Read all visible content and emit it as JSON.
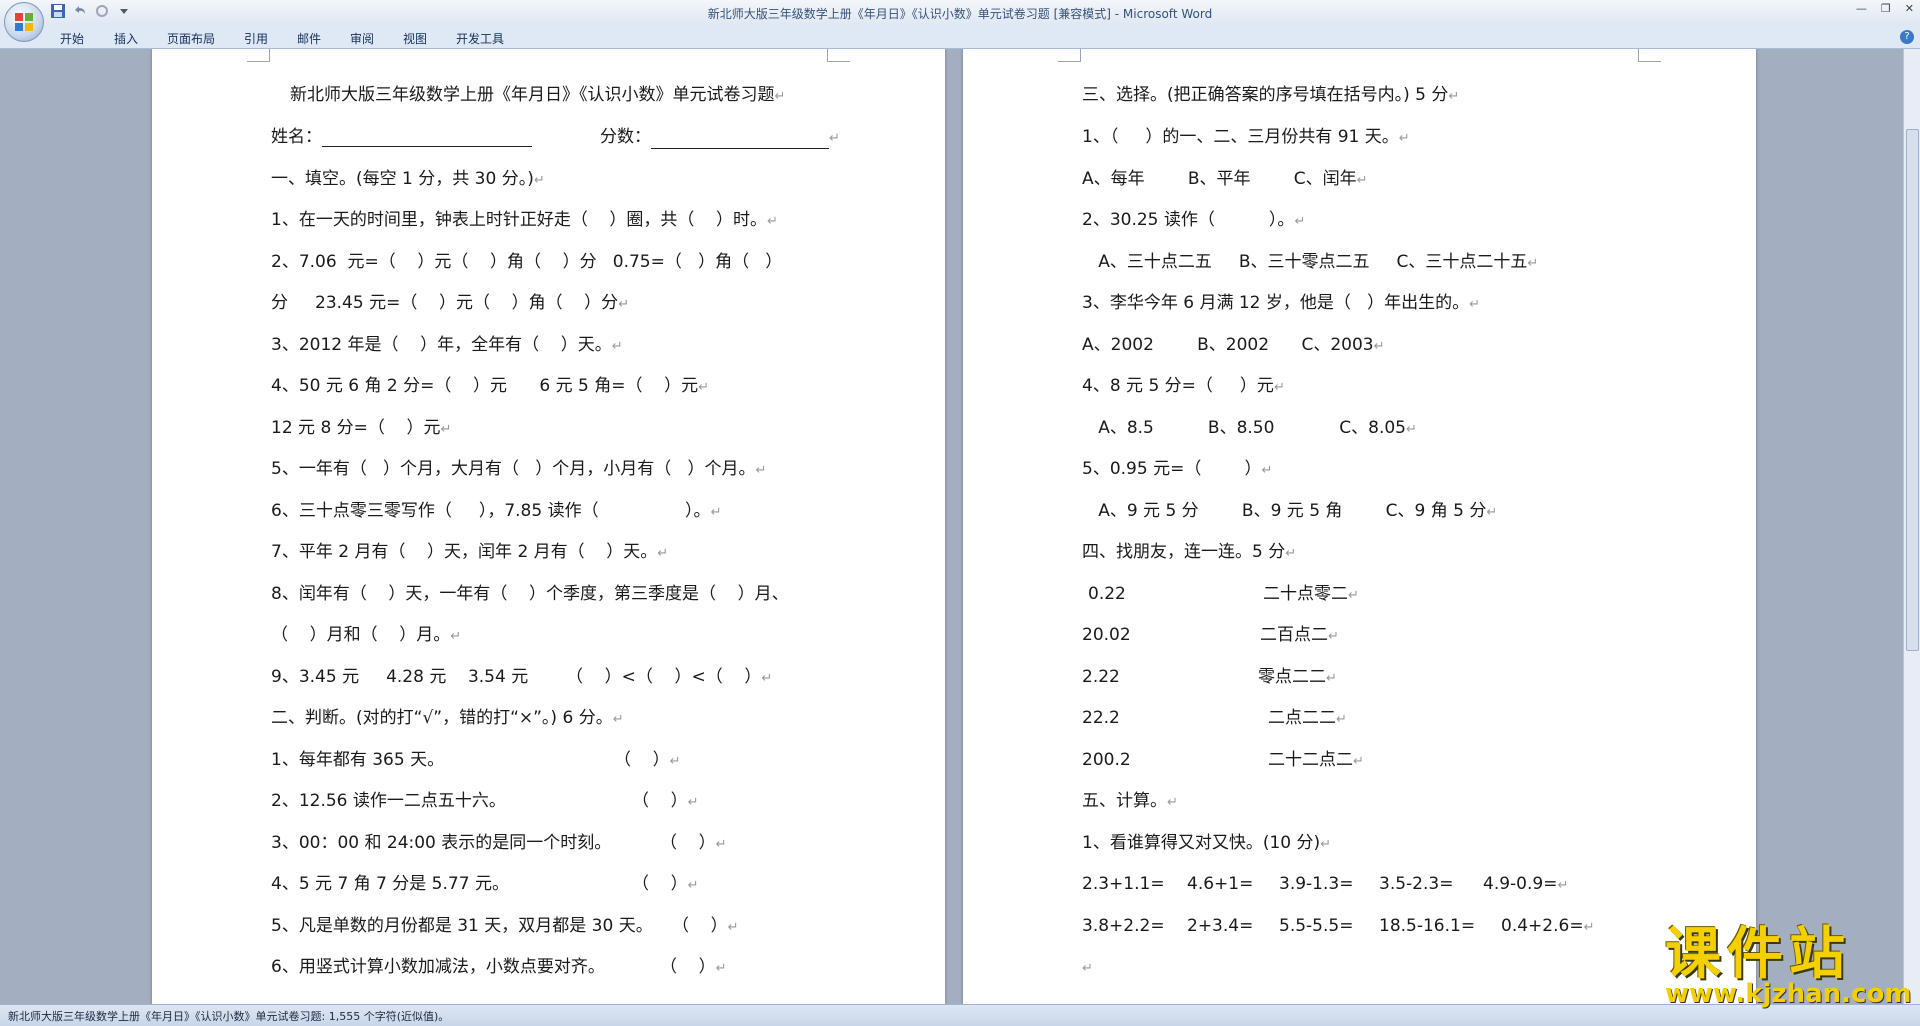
{
  "window": {
    "title": "新北师大版三年级数学上册《年月日》《认识小数》单元试卷习题 [兼容模式] - Microsoft Word"
  },
  "ribbon": {
    "tabs": [
      "开始",
      "插入",
      "页面布局",
      "引用",
      "邮件",
      "审阅",
      "视图",
      "开发工具"
    ]
  },
  "page1": {
    "lines": [
      "新北师大版三年级数学上册《年月日》《认识小数》单元试卷习题",
      "姓名：",
      "分数：",
      "一、填空。(每空 1 分，共 30 分。)",
      "1、在一天的时间里，钟表上时针正好走（    ）圈，共（    ）时。",
      "2、7.06  元=（    ）元（    ）角（    ）分   0.75=（   ）角（   ）",
      "分     23.45 元=（    ）元（    ）角（    ）分",
      "3、2012 年是（    ）年，全年有（    ）天。",
      "4、50 元 6 角 2 分=（    ）元      6 元 5 角=（    ）元",
      "12 元 8 分=（    ）元",
      "5、一年有（   ）个月，大月有（   ）个月，小月有（   ）个月。",
      "6、三十点零三零写作（     ），7.85 读作（                ）。",
      "7、平年 2 月有（    ）天，闰年 2 月有（    ）天。",
      "8、闰年有（    ）天，一年有（    ）个季度，第三季度是（    ）月、",
      "（    ）月和（    ）月。",
      "9、3.45 元     4.28 元    3.54 元       （    ）<（    ）<（    ）",
      "二、判断。(对的打“√”，错的打“×”。) 6 分。",
      "1、每年都有 365 天。",
      "2、12.56 读作一二点五十六。",
      "3、00：00 和 24:00 表示的是同一个时刻。",
      "4、5 元 7 角 7 分是 5.77 元。",
      "5、凡是单数的月份都是 31 天，双月都是 30 天。",
      "6、用竖式计算小数加减法，小数点要对齐。"
    ],
    "judge_parens": [
      "（    ）",
      "（    ）",
      "（    ）",
      "（    ）",
      "（    ）",
      "（    ）"
    ]
  },
  "page2": {
    "lines": [
      "三、选择。(把正确答案的序号填在括号内。) 5 分",
      "1、（     ）的一、二、三月份共有 91 天。",
      "A、每年        B、平年        C、闰年",
      "2、30.25 读作（          ）。",
      "   A、三十点二五     B、三十零点二五     C、三十点二十五",
      "3、李华今年 6 月满 12 岁，他是（   ）年出生的。",
      "A、2002        B、2002      C、2003",
      "4、8 元 5 分=（     ）元",
      "   A、8.5          B、8.50            C、8.05",
      "5、0.95 元=（        ）",
      "   A、9 元 5 分        B、9 元 5 角        C、9 角 5 分",
      "四、找朋友，连一连。5 分",
      "五、计算。",
      "1、看谁算得又对又快。(10 分)"
    ],
    "match_left": [
      "0.22",
      "20.02",
      "2.22",
      "22.2",
      "200.2"
    ],
    "match_right": [
      "二十点零二",
      "二百点二",
      "零点二二",
      "二点二二",
      "二十二点二"
    ],
    "calc_row1": [
      "2.3+1.1=",
      "4.6+1=",
      "3.9-1.3=",
      "3.5-2.3=",
      "4.9-0.9="
    ],
    "calc_row2": [
      "3.8+2.2=",
      "2+3.4=",
      "5.5-5.5=",
      "18.5-16.1=",
      "0.4+2.6="
    ]
  },
  "statusbar": {
    "text": "新北师大版三年级数学上册《年月日》《认识小数》单元试卷习题: 1,555 个字符(近似值)。"
  },
  "watermark": {
    "main": "课件站",
    "url": "www.kjzhan.com"
  },
  "colors": {
    "accent": "#35507a",
    "watermark": "#f5d000"
  }
}
